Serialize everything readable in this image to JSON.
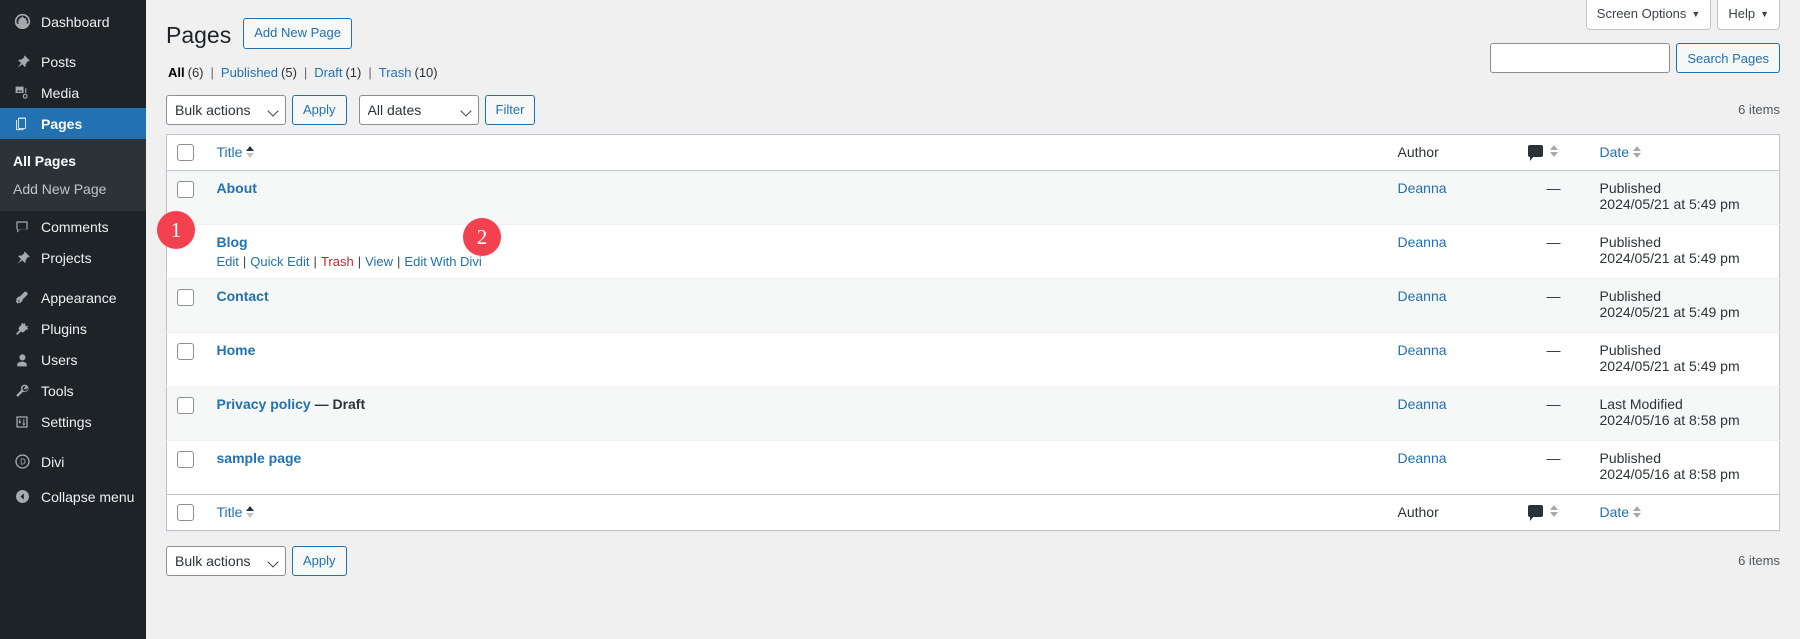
{
  "sidebar": {
    "items": [
      {
        "label": "Dashboard",
        "icon": "dashboard-icon",
        "current": false
      },
      {
        "label": "Posts",
        "icon": "pin-icon",
        "current": false
      },
      {
        "label": "Media",
        "icon": "media-icon",
        "current": false
      },
      {
        "label": "Pages",
        "icon": "pages-icon",
        "current": true
      },
      {
        "label": "Comments",
        "icon": "comment-icon",
        "current": false
      },
      {
        "label": "Projects",
        "icon": "pin-icon",
        "current": false
      },
      {
        "label": "Appearance",
        "icon": "brush-icon",
        "current": false
      },
      {
        "label": "Plugins",
        "icon": "plugin-icon",
        "current": false
      },
      {
        "label": "Users",
        "icon": "user-icon",
        "current": false
      },
      {
        "label": "Tools",
        "icon": "wrench-icon",
        "current": false
      },
      {
        "label": "Settings",
        "icon": "sliders-icon",
        "current": false
      },
      {
        "label": "Divi",
        "icon": "divi-icon",
        "current": false
      }
    ],
    "submenu": [
      {
        "label": "All Pages",
        "active": true
      },
      {
        "label": "Add New Page",
        "active": false
      }
    ],
    "collapse": {
      "label": "Collapse menu",
      "icon": "collapse-arrow-icon"
    }
  },
  "header": {
    "screen_options": "Screen Options",
    "help": "Help",
    "title": "Pages",
    "add_new": "Add New Page"
  },
  "views": {
    "all": {
      "label": "All",
      "count": "(6)"
    },
    "published": {
      "label": "Published",
      "count": "(5)"
    },
    "draft": {
      "label": "Draft",
      "count": "(1)"
    },
    "trash": {
      "label": "Trash",
      "count": "(10)"
    },
    "divider": "|"
  },
  "search": {
    "value": "",
    "placeholder": "",
    "button": "Search Pages"
  },
  "tablenav_top": {
    "bulk_actions": "Bulk actions",
    "apply": "Apply",
    "all_dates": "All dates",
    "filter": "Filter",
    "items_count": "6 items"
  },
  "tablenav_bottom": {
    "bulk_actions": "Bulk actions",
    "apply": "Apply",
    "items_count": "6 items"
  },
  "table": {
    "columns": {
      "title": "Title",
      "author": "Author",
      "comments": "comment-bubble-icon",
      "date": "Date"
    },
    "rows": [
      {
        "title": "About",
        "state": "",
        "author": "Deanna",
        "comments": "—",
        "date_status": "Published",
        "date_value": "2024/05/21 at 5:49 pm",
        "show_actions": false
      },
      {
        "title": "Blog",
        "state": "",
        "author": "Deanna",
        "comments": "—",
        "date_status": "Published",
        "date_value": "2024/05/21 at 5:49 pm",
        "show_actions": true,
        "actions": {
          "edit": "Edit",
          "quick_edit": "Quick Edit",
          "trash": "Trash",
          "view": "View",
          "edit_with_divi": "Edit With Divi",
          "separator": "|"
        }
      },
      {
        "title": "Contact",
        "state": "",
        "author": "Deanna",
        "comments": "—",
        "date_status": "Published",
        "date_value": "2024/05/21 at 5:49 pm",
        "show_actions": false
      },
      {
        "title": "Home",
        "state": "",
        "author": "Deanna",
        "comments": "—",
        "date_status": "Published",
        "date_value": "2024/05/21 at 5:49 pm",
        "show_actions": false
      },
      {
        "title": "Privacy policy",
        "state": "— Draft",
        "author": "Deanna",
        "comments": "—",
        "date_status": "Last Modified",
        "date_value": "2024/05/16 at 8:58 pm",
        "show_actions": false
      },
      {
        "title": "sample page",
        "state": "",
        "author": "Deanna",
        "comments": "—",
        "date_status": "Published",
        "date_value": "2024/05/16 at 8:58 pm",
        "show_actions": false
      }
    ]
  },
  "markers": [
    {
      "id": "marker-1",
      "label": "1"
    },
    {
      "id": "marker-2",
      "label": "2"
    }
  ],
  "colors": {
    "sidebar_bg": "#1d2327",
    "sidebar_submenu_bg": "#2c3338",
    "accent_blue": "#2271b1",
    "link_blue": "#2271b1",
    "trash_red": "#b32d2e",
    "marker_red": "#f4414f",
    "page_bg": "#f0f0f1"
  }
}
